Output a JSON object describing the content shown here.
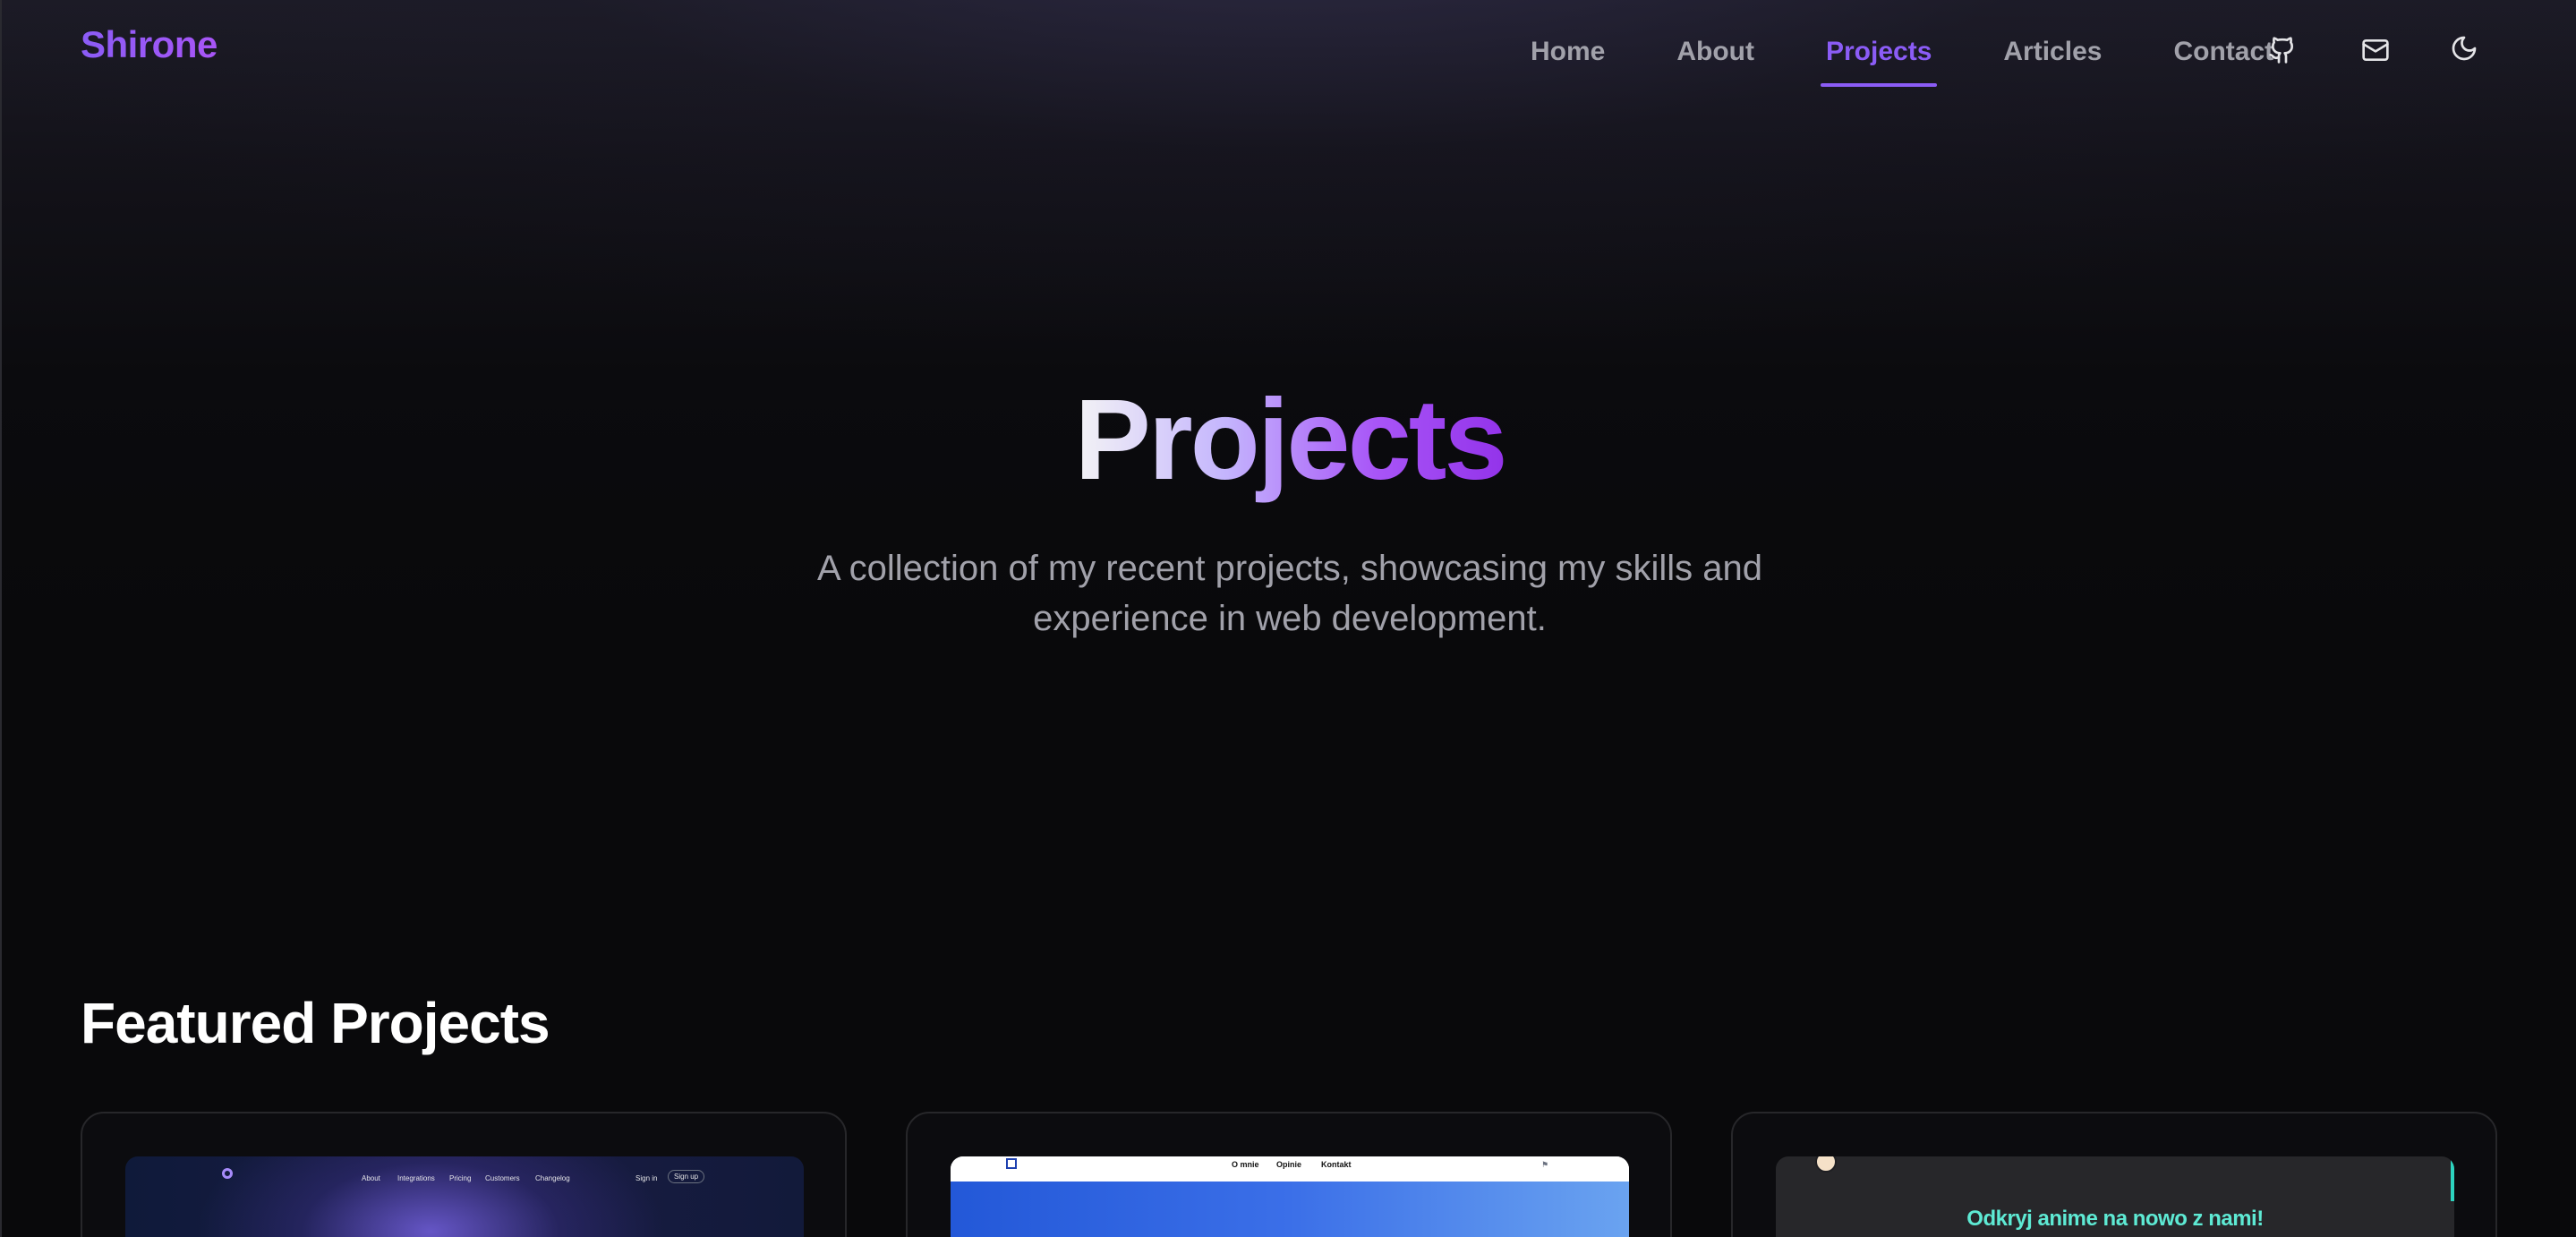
{
  "brand": {
    "name": "Shirone",
    "accent_color": "#8b5cf6"
  },
  "nav": {
    "items": [
      {
        "label": "Home",
        "active": false
      },
      {
        "label": "About",
        "active": false
      },
      {
        "label": "Projects",
        "active": true
      },
      {
        "label": "Articles",
        "active": false
      },
      {
        "label": "Contact",
        "active": false
      }
    ],
    "icons": [
      "github-icon",
      "mail-icon",
      "moon-icon"
    ]
  },
  "hero": {
    "title": "Projects",
    "subtitle": "A collection of my recent projects, showcasing my skills and experience in web development."
  },
  "featured": {
    "title": "Featured Projects",
    "cards": [
      {
        "preview_nav": [
          "About",
          "Integrations",
          "Pricing",
          "Customers",
          "Changelog"
        ],
        "preview_sign_in": "Sign in",
        "preview_sign_up": "Sign up"
      },
      {
        "preview_nav": [
          "O mnie",
          "Opinie",
          "Kontakt"
        ]
      },
      {
        "preview_heading": "Odkryj anime na nowo z nami!"
      }
    ]
  }
}
